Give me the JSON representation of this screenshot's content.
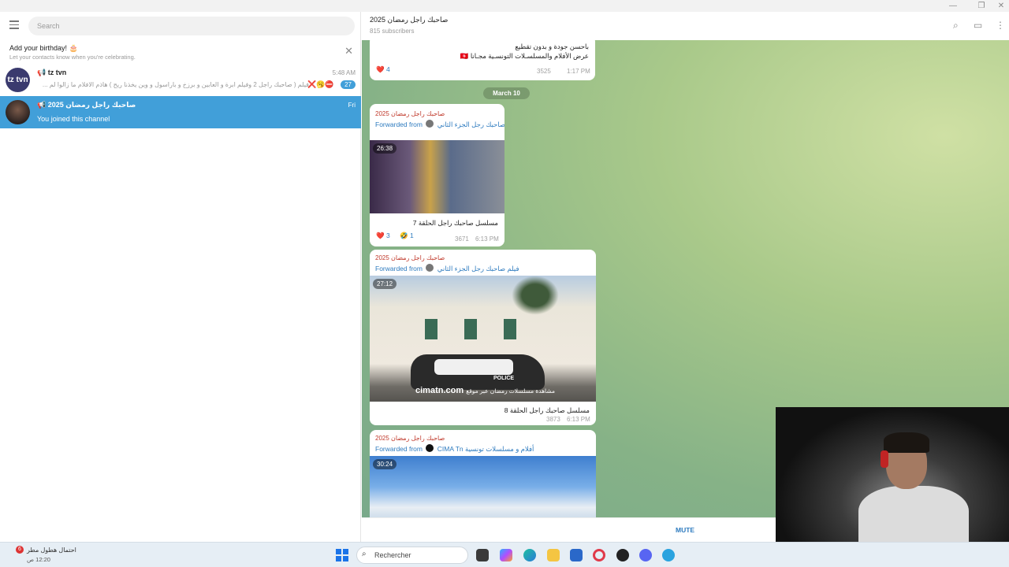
{
  "window": {
    "min_icon": "minimize-icon",
    "restore_icon": "restore-icon",
    "close_icon": "close-icon"
  },
  "sidebar": {
    "search_placeholder": "Search",
    "birthday": {
      "title": "Add your birthday! 🎂",
      "subtitle": "Let your contacts know when you're celebrating.",
      "close": "✕"
    },
    "chats": [
      {
        "avatar_text": "tz tvn",
        "name": "📢 tz tvn",
        "time": "5:48 AM",
        "preview": "فيلم ( صاحبك راجل 2 وفيلم ابرة و العابين و برزخ و باراسول و وين يخذنا ريح ) هاذم الافلام ما زالوا لم ...",
        "emojis": "❌🥱⛔",
        "unread": "27"
      },
      {
        "name": "📢 صاحبك راجل رمضان 2025",
        "time": "Fri",
        "subtitle": "You joined this channel"
      }
    ]
  },
  "channel": {
    "title": "صاحبك راجل رمضان 2025",
    "subscribers": "815 subscribers",
    "search_icon": "search-icon",
    "sidebar_icon": "sidebar-toggle-icon",
    "more_icon": "more-vertical-icon"
  },
  "messages": {
    "top": {
      "line1": "باحسن جودة و بدون تقطيع",
      "line2": "عرض الأفلام والمسلسـلات التونسـية مجـانا 🇹🇳",
      "reaction": "❤️ 4",
      "views": "3525",
      "time": "1:17 PM"
    },
    "date": "March 10",
    "msg1": {
      "source": "صاحبك راجل رمضان 2025",
      "fwd_prefix": "Forwarded from",
      "fwd_name": "فيلم صاحبك رجل الجزء الثاني",
      "duration": "26:38",
      "caption": "مسلسل صاحبك راجل الحلقة 7",
      "reaction1": "❤️ 3",
      "reaction2": "🤣 1",
      "views": "3671",
      "time": "6:13 PM"
    },
    "msg2": {
      "source": "صاحبك راجل رمضان 2025",
      "fwd_prefix": "Forwarded from",
      "fwd_name": "فيلم صاحبك رجل الجزء الثاني",
      "duration": "27:12",
      "watermark": "cimatn.com",
      "watermark_ar": "مشاهدة مسلسلات رمضان عبر موقع",
      "police": "POLICE",
      "caption": "مسلسل صاحبك راجل الحلقة 8",
      "views": "3873",
      "time": "6:13 PM"
    },
    "msg3": {
      "source": "صاحبك راجل رمضان 2025",
      "fwd_prefix": "Forwarded from",
      "fwd_name": "CIMA Tn أفلام و مسلسلات تونسية",
      "duration": "30:24"
    }
  },
  "mute_label": "MUTE",
  "taskbar": {
    "weather_badge": "6",
    "weather_line1": "احتمال هطول مطر",
    "weather_line2": "12:20 ص",
    "search_text": "Rechercher",
    "apps": [
      "file-explorer-icon",
      "copilot-icon",
      "edge-icon",
      "folder-icon",
      "store-icon",
      "opera-icon",
      "steam-icon",
      "discord-icon",
      "telegram-icon"
    ]
  }
}
